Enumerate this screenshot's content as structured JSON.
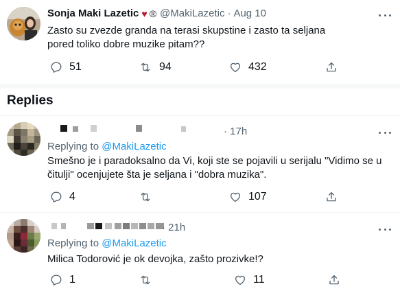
{
  "main_tweet": {
    "author_name": "Sonja Maki Lazetic",
    "emoji_heart": "♥",
    "emoji_reg": "®",
    "handle": "@MakiLazetic",
    "separator": "·",
    "time": "Aug 10",
    "text": "Zasto su zvezde granda na terasi skupstine i zasto ta seljana pored toliko dobre muzike pitam??",
    "replies": "51",
    "retweets": "94",
    "likes": "432"
  },
  "replies_heading": "Replies",
  "reply_1": {
    "time": "· 17h",
    "replying_prefix": "Replying to ",
    "replying_to": "@MakiLazetic",
    "text": "Smešno je i paradoksalno da Vi, koji ste se pojavili u serijalu \"Vidimo se u čitulji\" ocenjujete šta je seljana i \"dobra muzika\".",
    "replies": "4",
    "retweets": "",
    "likes": "107"
  },
  "reply_2": {
    "time": "· 21h",
    "replying_prefix": "Replying to ",
    "replying_to": "@MakiLazetic",
    "text": "Milica Todorović je ok devojka, zašto prozivke!?",
    "replies": "1",
    "retweets": "",
    "likes": "11"
  },
  "colors": {
    "text": "#0f1419",
    "secondary": "#536471",
    "link": "#1d9bf0",
    "heart": "#c0142f",
    "divider": "#eff3f4"
  }
}
